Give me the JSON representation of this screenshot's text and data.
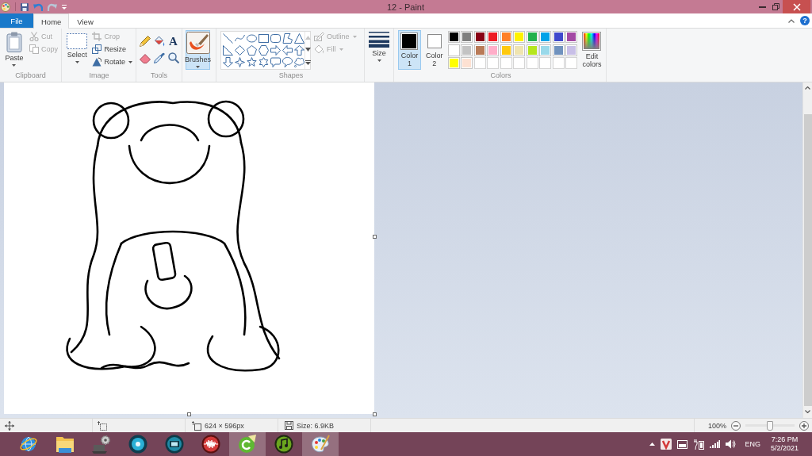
{
  "window": {
    "title": "12 - Paint",
    "quick_access": [
      {
        "kind": "save",
        "disabled": false
      },
      {
        "kind": "undo",
        "disabled": false
      },
      {
        "kind": "redo",
        "disabled": true
      }
    ]
  },
  "tabs": [
    {
      "kind": "menu",
      "label": "File",
      "selected": false
    },
    {
      "kind": "tab",
      "label": "Home",
      "selected": true
    },
    {
      "kind": "tab",
      "label": "View",
      "selected": false
    }
  ],
  "help": "?",
  "ribbon": {
    "clipboard": {
      "label": "Clipboard",
      "paste": "Paste",
      "actions": [
        {
          "kind": "cut",
          "label": "Cut",
          "disabled": true,
          "dropdown": false
        },
        {
          "kind": "copy",
          "label": "Copy",
          "disabled": true,
          "dropdown": false
        }
      ]
    },
    "image": {
      "label": "Image",
      "select": "Select",
      "actions": [
        {
          "kind": "crop",
          "label": "Crop",
          "disabled": true,
          "dropdown": false
        },
        {
          "kind": "resize",
          "label": "Resize",
          "disabled": false,
          "dropdown": false
        },
        {
          "kind": "rotate",
          "label": "Rotate",
          "disabled": false,
          "dropdown": true
        }
      ]
    },
    "tools": {
      "label": "Tools",
      "text_tool": "A"
    },
    "brushes": {
      "label": "Brushes",
      "selected": true
    },
    "shapes": {
      "label": "Shapes",
      "actions": [
        {
          "kind": "outline",
          "label": "Outline",
          "disabled": true,
          "dropdown": true
        },
        {
          "kind": "fill",
          "label": "Fill",
          "disabled": true,
          "dropdown": true
        }
      ]
    },
    "size": {
      "label": "Size"
    },
    "colors": {
      "label": "Colors",
      "color_1": {
        "label": "Color 1",
        "color": "#000000",
        "selected": true
      },
      "color_2": {
        "label": "Color 2",
        "color": "#ffffff",
        "selected": false
      },
      "palette": [
        {
          "color": "#000000"
        },
        {
          "color": "#7f7f7f"
        },
        {
          "color": "#880015"
        },
        {
          "color": "#ed1c24"
        },
        {
          "color": "#ff7f27"
        },
        {
          "color": "#fff200"
        },
        {
          "color": "#22b14c"
        },
        {
          "color": "#00a2e8"
        },
        {
          "color": "#3f48cc"
        },
        {
          "color": "#a349a4"
        },
        {
          "color": "#ffffff"
        },
        {
          "color": "#c3c3c3"
        },
        {
          "color": "#b97a57"
        },
        {
          "color": "#ffaec9"
        },
        {
          "color": "#ffc90e"
        },
        {
          "color": "#efe4b0"
        },
        {
          "color": "#b5e61d"
        },
        {
          "color": "#99d9ea"
        },
        {
          "color": "#7092be"
        },
        {
          "color": "#c8bfe7"
        },
        {
          "color": "#ffff00"
        },
        {
          "color": "#fde1d2"
        }
      ],
      "edit": "Edit colors"
    }
  },
  "status_bar": {
    "image_size": "624 × 596px",
    "file_size": "Size: 6.9KB",
    "zoom": "100%",
    "zoom_slider": {
      "level": 0.5
    }
  },
  "taskbar": {
    "apps": [
      {
        "kind": "globe",
        "open": false
      },
      {
        "kind": "folder",
        "open": false
      },
      {
        "kind": "laptop",
        "open": false
      },
      {
        "kind": "disc",
        "open": false
      },
      {
        "kind": "film",
        "open": false
      },
      {
        "kind": "wave",
        "open": false
      },
      {
        "kind": "arc",
        "open": true
      },
      {
        "kind": "music",
        "open": false
      },
      {
        "kind": "palette",
        "open": true
      }
    ],
    "language": "ENG",
    "time": "7:26 PM",
    "date": "5/2/2021"
  }
}
